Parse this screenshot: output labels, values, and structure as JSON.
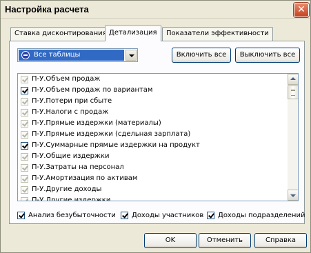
{
  "window": {
    "title": "Настройка расчета"
  },
  "tabs": [
    {
      "label": "Ставка дисконтирования"
    },
    {
      "label": "Детализация"
    },
    {
      "label": "Показатели эффективности"
    }
  ],
  "table_select": {
    "selected": "Все таблицы"
  },
  "buttons": {
    "enable_all": "Включить все",
    "disable_all": "Выключить все",
    "ok": "OK",
    "cancel": "Отменить",
    "help": "Справка"
  },
  "list_items": [
    {
      "label": "П-У.Объем продаж",
      "checked": true,
      "enabled": false
    },
    {
      "label": "П-У.Объем продаж по вариантам",
      "checked": true,
      "enabled": true
    },
    {
      "label": "П-У.Потери при сбыте",
      "checked": true,
      "enabled": false
    },
    {
      "label": "П-У.Налоги с продаж",
      "checked": true,
      "enabled": false
    },
    {
      "label": "П-У.Прямые издержки (материалы)",
      "checked": true,
      "enabled": false
    },
    {
      "label": "П-У.Прямые издержки (сдельная зарплата)",
      "checked": true,
      "enabled": false
    },
    {
      "label": "П-У.Суммарные прямые издержки на продукт",
      "checked": true,
      "enabled": true
    },
    {
      "label": "П-У.Общие издержки",
      "checked": true,
      "enabled": false
    },
    {
      "label": "П-У.Затраты на персонал",
      "checked": true,
      "enabled": false
    },
    {
      "label": "П-У.Амортизация по активам",
      "checked": true,
      "enabled": false
    },
    {
      "label": "П-У.Другие доходы",
      "checked": true,
      "enabled": false
    },
    {
      "label": "П-У.Другие издержки",
      "checked": true,
      "enabled": false
    }
  ],
  "options": {
    "breakeven": "Анализ безубыточности",
    "participants_income": "Доходы участников",
    "divisions_income": "Доходы подразделений"
  }
}
